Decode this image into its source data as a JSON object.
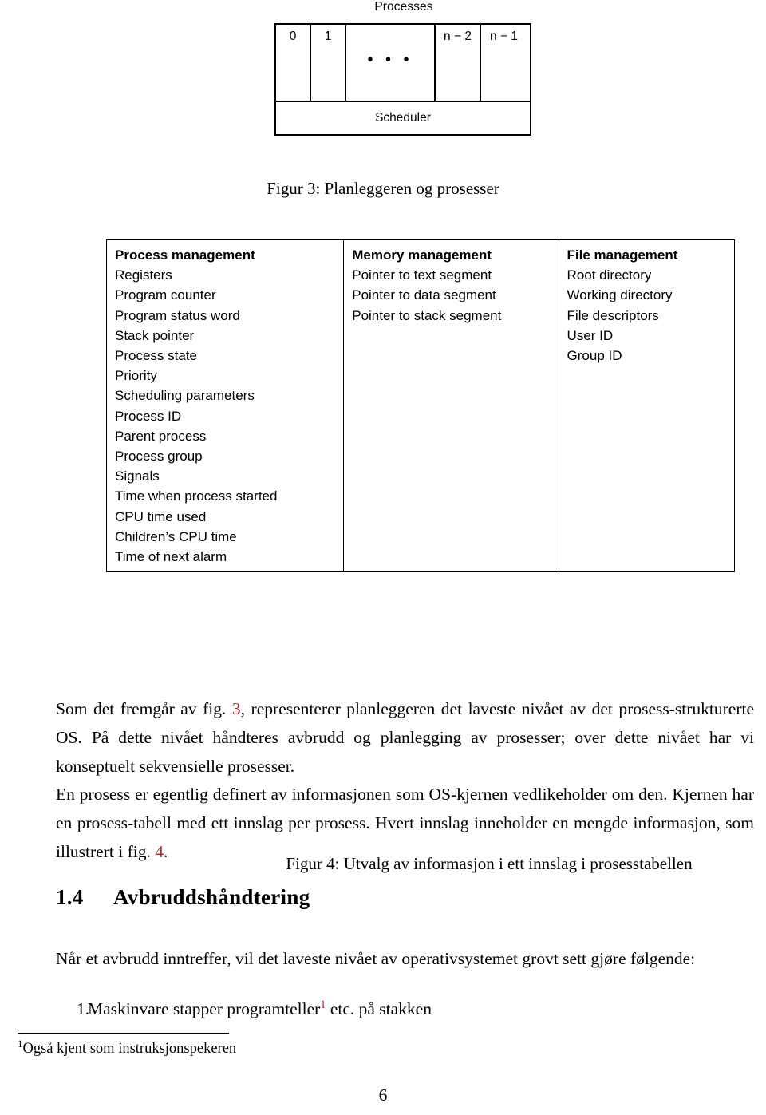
{
  "figure3": {
    "title": "Processes",
    "cells": [
      {
        "label": "0"
      },
      {
        "label": "1"
      },
      {
        "label": ""
      },
      {
        "label": "n − 2"
      },
      {
        "label": "n − 1"
      }
    ],
    "ellipsis": "• • •",
    "scheduler_label": "Scheduler",
    "caption": "Figur 3: Planleggeren og prosesser"
  },
  "figure4": {
    "columns": [
      {
        "header": "Process management",
        "items": [
          "Registers",
          "Program counter",
          "Program status word",
          "Stack pointer",
          "Process state",
          "Priority",
          "Scheduling parameters",
          "Process ID",
          "Parent process",
          "Process group",
          "Signals",
          "Time when process started",
          "CPU time used",
          "Children’s CPU time",
          "Time of next alarm"
        ]
      },
      {
        "header": "Memory management",
        "items": [
          "Pointer to text segment",
          "Pointer to data segment",
          "Pointer to stack segment"
        ]
      },
      {
        "header": "File management",
        "items": [
          "Root directory",
          "Working directory",
          "File descriptors",
          "User ID",
          "Group ID"
        ]
      }
    ],
    "caption": "Figur 4: Utvalg av informasjon i ett innslag i prosesstabellen"
  },
  "body": {
    "paragraph1_before_ref": "Som det fremgår av fig. ",
    "paragraph1_ref": "3",
    "paragraph1_after_ref": ", representerer planleggeren det laveste nivået av det prosess-strukturerte OS. På dette nivået håndteres avbrudd og planlegging av prosesser; over dette nivået har vi konseptuelt sekvensielle prosesser.",
    "paragraph2_before_ref": "En prosess er egentlig definert av informasjonen som OS-kjernen vedlikeholder om den. Kjernen har en prosess-tabell med ett innslag per prosess. Hvert innslag inneholder en mengde informasjon, som illustrert i fig. ",
    "paragraph2_ref": "4",
    "paragraph2_after_ref": ".",
    "section_number": "1.4",
    "section_title": "Avbruddshåndtering",
    "paragraph3": "Når et avbrudd inntreffer, vil det laveste nivået av operativsystemet grovt sett gjøre følgende:",
    "list": [
      {
        "number": "1.",
        "text_before_marker": "Maskinvare stapper programteller",
        "footnote_marker": "1",
        "text_after_marker": " etc. på stakken"
      }
    ]
  },
  "footnote": {
    "marker": "1",
    "text": "Også kjent som instruksjonspekeren"
  },
  "page_number": "6",
  "colors": {
    "reference_link": "#b03030",
    "text": "#000000",
    "background": "#ffffff"
  }
}
